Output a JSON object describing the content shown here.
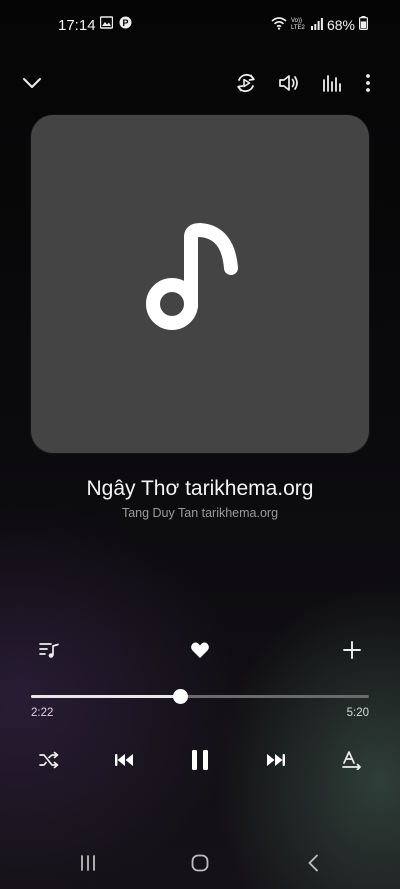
{
  "status_bar": {
    "time": "17:14",
    "signal_label": "Vo)) LTE2",
    "battery": "68%",
    "icons": [
      "image-icon",
      "pinterest-icon",
      "wifi-icon",
      "signal-icon",
      "battery-icon"
    ]
  },
  "toolbar": {
    "icons": [
      "chevron-down-icon",
      "smart-view-icon",
      "volume-icon",
      "equalizer-icon",
      "more-icon"
    ]
  },
  "album_art": {
    "icon": "music-note-icon"
  },
  "track": {
    "title": "Ngây Thơ tarikhema.org",
    "artist": "Tang Duy Tan tarikhema.org"
  },
  "actions": {
    "icons": [
      "queue-icon",
      "heart-icon",
      "add-icon"
    ],
    "favorite": true
  },
  "progress": {
    "elapsed": "2:22",
    "total": "5:20",
    "fraction": 0.44
  },
  "controls": {
    "icons": [
      "shuffle-icon",
      "previous-icon",
      "pause-icon",
      "next-icon",
      "repeat-icon"
    ]
  },
  "nav_bar": {
    "icons": [
      "recent-apps-icon",
      "home-icon",
      "back-icon"
    ]
  },
  "colors": {
    "accent": "#ffffff",
    "album_background": "#444444",
    "secondary_text": "#9a9a9a"
  }
}
